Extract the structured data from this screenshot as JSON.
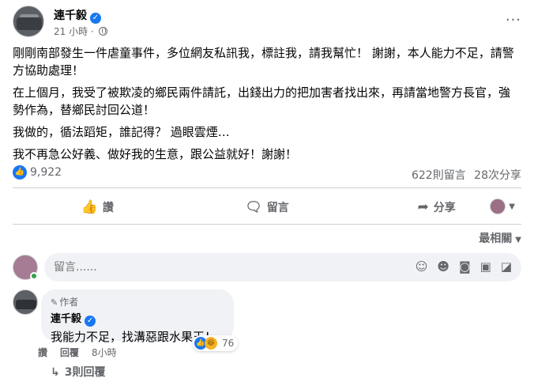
{
  "post": {
    "author": "連千毅",
    "time": "21 小時",
    "body": [
      "剛剛南部發生一件虐童事件，多位網友私訊我，標註我，請我幫忙！ 謝謝，本人能力不足，請警方協助處理！",
      "在上個月，我受了被欺凌的鄉民兩件請託，出錢出力的把加害者找出來，再請當地警方長官，強勢作為，替鄉民討回公道！",
      "我做的，循法蹈矩，誰記得？ 過眼雲煙…",
      "我不再急公好義、做好我的生意，跟公益就好！謝謝！"
    ]
  },
  "stats": {
    "reactions": "9,922",
    "comments": "622則留言",
    "shares": "28次分享"
  },
  "actions": {
    "like": "讚",
    "comment": "留言",
    "share": "分享"
  },
  "sort": {
    "label": "最相關"
  },
  "composer": {
    "placeholder": "留言......"
  },
  "comment": {
    "author_tag": "作者",
    "name": "連千毅",
    "text": "我能力不足，找溝惡跟水果王！",
    "reaction_count": "76",
    "like_label": "讚",
    "reply_label": "回覆",
    "time": "8小時"
  },
  "replies": {
    "label": "3則回覆"
  },
  "icons": {
    "verified": "verified-badge-icon",
    "globe": "globe-icon",
    "like": "thumbs-up-icon",
    "comment": "speech-bubble-icon",
    "share": "share-arrow-icon"
  },
  "colors": {
    "accent": "#1877f2",
    "muted": "#65676b",
    "bubble": "#f0f2f5",
    "online": "#31a24c"
  }
}
